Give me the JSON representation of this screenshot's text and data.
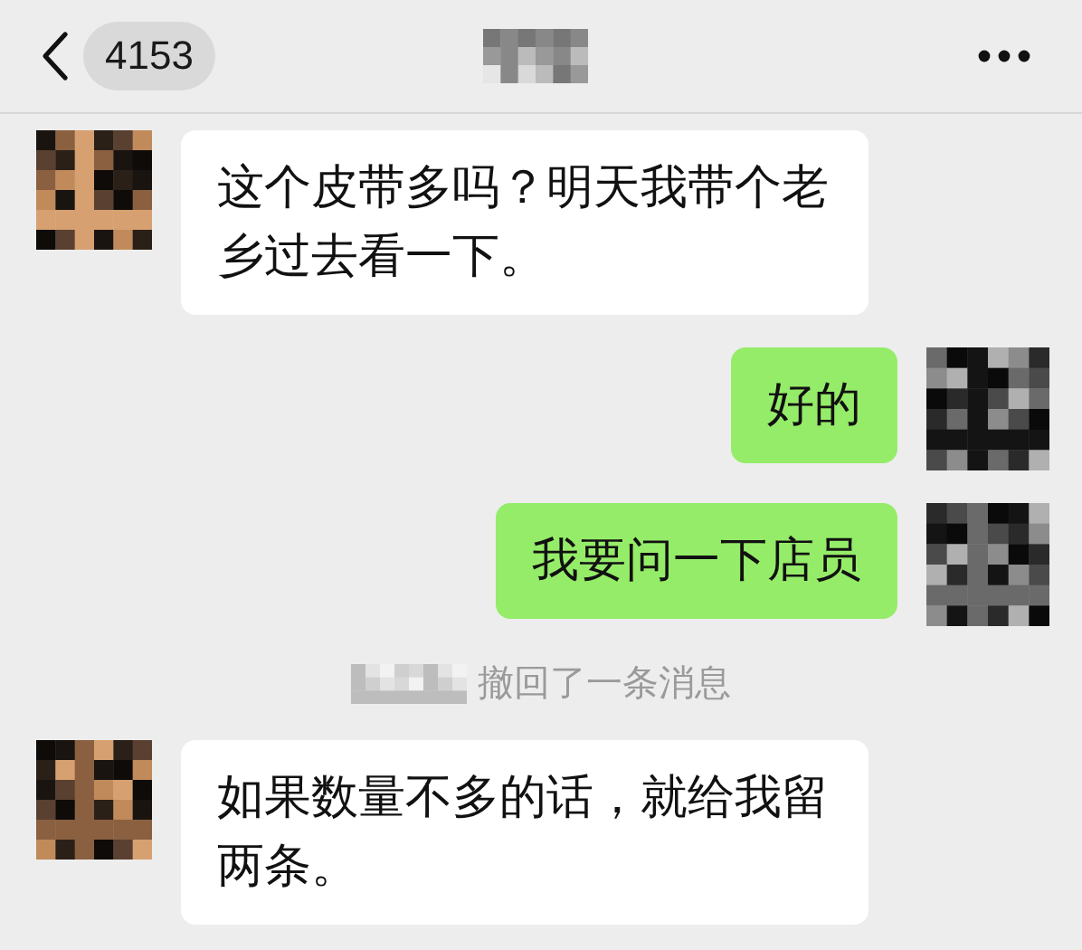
{
  "header": {
    "back_count": "4153"
  },
  "messages": [
    {
      "kind": "incoming",
      "text": "这个皮带多吗？明天我带个老乡过去看一下。"
    },
    {
      "kind": "outgoing",
      "text": "好的"
    },
    {
      "kind": "outgoing",
      "text": "我要问一下店员"
    },
    {
      "kind": "recall",
      "text": "撤回了一条消息"
    },
    {
      "kind": "incoming",
      "text": "如果数量不多的话，就给我留两条。"
    }
  ]
}
